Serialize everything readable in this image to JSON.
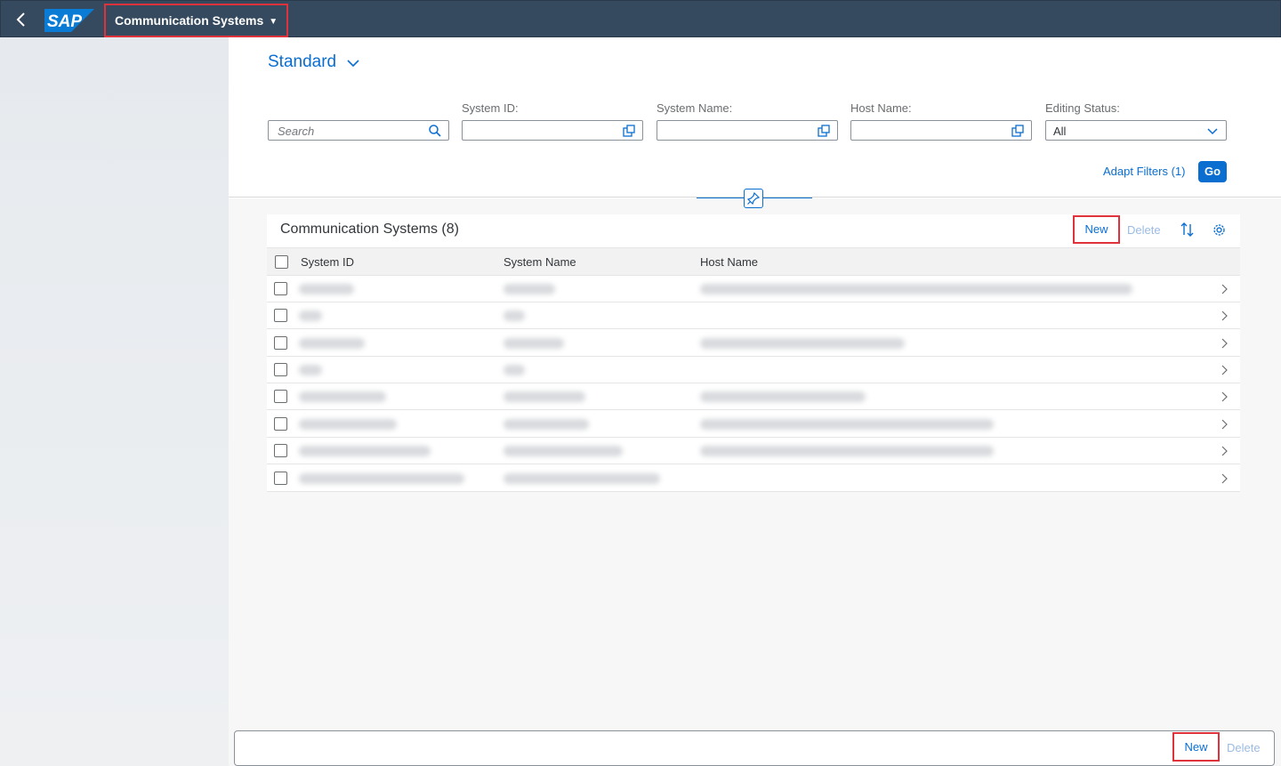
{
  "shell": {
    "app_title": "Communication Systems",
    "logo_text": "SAP"
  },
  "filters": {
    "variant": "Standard",
    "search_placeholder": "Search",
    "system_id_label": "System ID:",
    "system_name_label": "System Name:",
    "host_name_label": "Host Name:",
    "editing_status_label": "Editing Status:",
    "editing_status_value": "All",
    "adapt_filters": "Adapt Filters (1)",
    "go": "Go"
  },
  "table": {
    "title": "Communication Systems (8)",
    "new_label": "New",
    "delete_label": "Delete",
    "columns": [
      "System ID",
      "System Name",
      "Host Name"
    ]
  },
  "footer": {
    "new_label": "New",
    "delete_label": "Delete"
  },
  "colors": {
    "shell": "#354a5f",
    "accent": "#0a6ed1",
    "highlight": "#e0323b"
  }
}
